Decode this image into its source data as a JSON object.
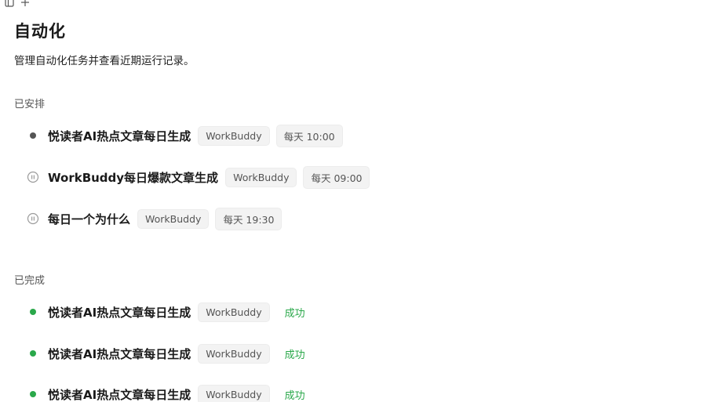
{
  "page": {
    "title": "自动化",
    "subtitle": "管理自动化任务并查看近期运行记录。"
  },
  "sections": {
    "scheduled": {
      "label": "已安排",
      "items": [
        {
          "name": "悦读者AI热点文章每日生成",
          "tag": "WorkBuddy",
          "schedule": "每天 10:00",
          "status": "active",
          "status_icon": "dot-icon"
        },
        {
          "name": "WorkBuddy每日爆款文章生成",
          "tag": "WorkBuddy",
          "schedule": "每天 09:00",
          "status": "paused",
          "status_icon": "pause-circle-icon"
        },
        {
          "name": "每日一个为什么",
          "tag": "WorkBuddy",
          "schedule": "每天 19:30",
          "status": "paused",
          "status_icon": "pause-circle-icon"
        }
      ]
    },
    "completed": {
      "label": "已完成",
      "items": [
        {
          "name": "悦读者AI热点文章每日生成",
          "tag": "WorkBuddy",
          "result": "成功",
          "status_icon": "green-dot-icon"
        },
        {
          "name": "悦读者AI热点文章每日生成",
          "tag": "WorkBuddy",
          "result": "成功",
          "status_icon": "green-dot-icon"
        },
        {
          "name": "悦读者AI热点文章每日生成",
          "tag": "WorkBuddy",
          "result": "成功",
          "status_icon": "green-dot-icon"
        }
      ]
    }
  },
  "colors": {
    "active_dot": "#555555",
    "success": "#2aa84a",
    "paused_icon": "#9a9a9a",
    "tag_bg": "#f3f3f3"
  }
}
